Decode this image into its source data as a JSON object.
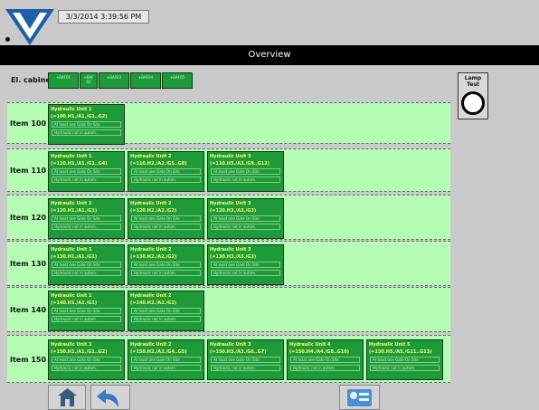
{
  "header": {
    "datetime": "3/3/2014 3:39:56 PM"
  },
  "title": "Overview",
  "el_cabinet": {
    "label": "El. cabinet",
    "items": [
      "+BAF01",
      "+BAF 02",
      "+BAF03",
      "+BAF04",
      "+BAF05"
    ]
  },
  "lamp_test": {
    "label_line1": "Lamp",
    "label_line2": "Test"
  },
  "rows": [
    {
      "label": "Item 100",
      "units": [
        {
          "name": "Hydraulic Unit 1",
          "code": "(=100.H1./A1./G1..G2)",
          "status1": "At least one Gate On Site",
          "status2": "Hydraulic not in autom."
        }
      ]
    },
    {
      "label": "Item 110",
      "units": [
        {
          "name": "Hydraulic Unit 1",
          "code": "(=110.H1./A1./G1..G4)",
          "status1": "At least one Gate On Site",
          "status2": "Hydraulic not in autom."
        },
        {
          "name": "Hydraulic Unit 2",
          "code": "(=110.H2./A2./G5..G8)",
          "status1": "At least one Gate On Site",
          "status2": "Hydraulic not in autom."
        },
        {
          "name": "Hydraulic Unit 3",
          "code": "(=110.H3./A3./G9..G12)",
          "status1": "At least one Gate On Site",
          "status2": "Hydraulic not in autom."
        }
      ]
    },
    {
      "label": "Item 120",
      "units": [
        {
          "name": "Hydraulic Unit 1",
          "code": "(=120.H1./A1./G1)",
          "status1": "At least one Gate On Site",
          "status2": "Hydraulic not in autom."
        },
        {
          "name": "Hydraulic Unit 2",
          "code": "(=120.H2./A2./G2)",
          "status1": "At least one Gate On Site",
          "status2": "Hydraulic not in autom."
        },
        {
          "name": "Hydraulic Unit 3",
          "code": "(=120.H3./A3./G3)",
          "status1": "At least one Gate On Site",
          "status2": "Hydraulic not in autom."
        }
      ]
    },
    {
      "label": "Item 130",
      "units": [
        {
          "name": "Hydraulic Unit 1",
          "code": "(=130.H1./A1./G1)",
          "status1": "At least one Gate On Site",
          "status2": "Hydraulic not in autom."
        },
        {
          "name": "Hydraulic Unit 2",
          "code": "(=130.H2./A2./G2)",
          "status1": "At least one Gate On Site",
          "status2": "Hydraulic not in autom."
        },
        {
          "name": "Hydraulic Unit 3",
          "code": "(=130.H3./A3./G3)",
          "status1": "At least one Gate On Site",
          "status2": "Hydraulic not in autom."
        }
      ]
    },
    {
      "label": "Item 140",
      "units": [
        {
          "name": "Hydraulic Unit 1",
          "code": "(=140.H1./A1./G1)",
          "status1": "At least one Gate On Site",
          "status2": "Hydraulic not in autom."
        },
        {
          "name": "Hydraulic Unit 2",
          "code": "(=140.H2./A2./G2)",
          "status1": "At least one Gate On Site",
          "status2": "Hydraulic not in autom."
        }
      ]
    },
    {
      "label": "Item 150",
      "units": [
        {
          "name": "Hydraulic Unit 1",
          "code": "(=150.H1./A1./G1..G2)",
          "status1": "At least one Gate On Site",
          "status2": "Hydraulic not in autom."
        },
        {
          "name": "Hydraulic Unit 2",
          "code": "(=150.H2./A2./G4..G5)",
          "status1": "At least one Gate On Site",
          "status2": "Hydraulic not in autom."
        },
        {
          "name": "Hydraulic Unit 3",
          "code": "(=150.H3./A3./G6..G7)",
          "status1": "At least one Gate On Site",
          "status2": "Hydraulic not in autom."
        },
        {
          "name": "Hydraulic Unit 4",
          "code": "(=150.H4./A4./G8..G10)",
          "status1": "At least one Gate On Site",
          "status2": "Hydraulic not in autom."
        },
        {
          "name": "Hydraulic Unit 5",
          "code": "(=150.H5./A5./G11..G13)",
          "status1": "At least one Gate On Site",
          "status2": "Hydraulic not in autom."
        }
      ]
    }
  ],
  "footer": {
    "icons": [
      "home-icon",
      "back-arrow-icon",
      "system-settings-icon"
    ]
  }
}
